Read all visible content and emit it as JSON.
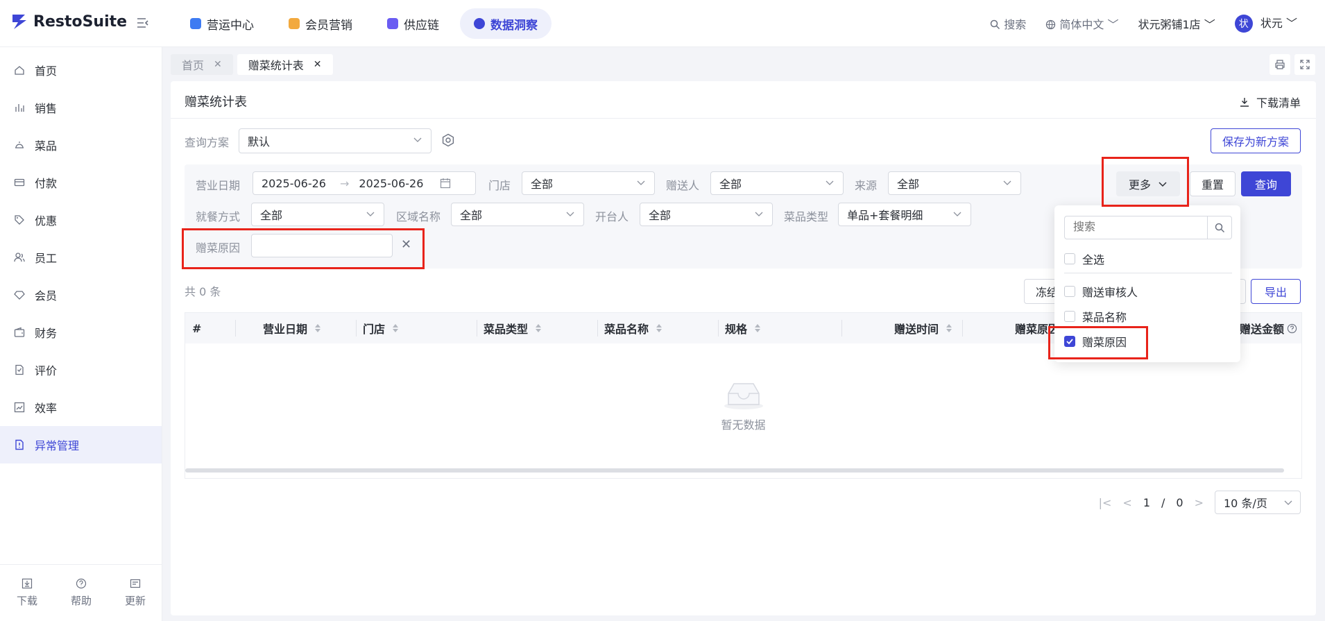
{
  "app": {
    "logo": "RestoSuite"
  },
  "nav": {
    "tabs": [
      {
        "label": "营运中心",
        "color": "#3e7bf2"
      },
      {
        "label": "会员营销",
        "color": "#f2a93e"
      },
      {
        "label": "供应链",
        "color": "#6a5cf2"
      },
      {
        "label": "数据洞察",
        "color": "#3e46d6"
      }
    ],
    "active": "数据洞察"
  },
  "topright": {
    "search": "搜索",
    "language": "简体中文",
    "store": "状元粥铺1店",
    "avatar_char": "状",
    "user": "状元"
  },
  "sidebar": {
    "items": [
      {
        "label": "首页",
        "icon": "home-icon"
      },
      {
        "label": "销售",
        "icon": "bar-chart-icon"
      },
      {
        "label": "菜品",
        "icon": "dish-icon"
      },
      {
        "label": "付款",
        "icon": "card-icon"
      },
      {
        "label": "优惠",
        "icon": "tag-icon"
      },
      {
        "label": "员工",
        "icon": "staff-icon"
      },
      {
        "label": "会员",
        "icon": "diamond-icon"
      },
      {
        "label": "财务",
        "icon": "wallet-icon"
      },
      {
        "label": "评价",
        "icon": "review-icon"
      },
      {
        "label": "效率",
        "icon": "trend-icon"
      },
      {
        "label": "异常管理",
        "icon": "alert-doc-icon"
      }
    ],
    "active": "异常管理",
    "bottom": [
      {
        "label": "下载",
        "icon": "download-icon"
      },
      {
        "label": "帮助",
        "icon": "help-icon"
      },
      {
        "label": "更新",
        "icon": "update-icon"
      }
    ]
  },
  "pagetabs": [
    {
      "label": "首页"
    },
    {
      "label": "赠菜统计表"
    }
  ],
  "page": {
    "title": "赠菜统计表",
    "download_list": "下载清单",
    "plan_label": "查询方案",
    "plan_value": "默认",
    "save_plan": "保存为新方案"
  },
  "filters": {
    "biz_date_label": "营业日期",
    "date_start": "2025-06-26",
    "date_end": "2025-06-26",
    "store_label": "门店",
    "store_value": "全部",
    "giver_label": "赠送人",
    "giver_value": "全部",
    "source_label": "来源",
    "source_value": "全部",
    "dining_label": "就餐方式",
    "dining_value": "全部",
    "area_label": "区域名称",
    "area_value": "全部",
    "opener_label": "开台人",
    "opener_value": "全部",
    "dishtype_label": "菜品类型",
    "dishtype_value": "单品+套餐明细",
    "reason_label": "赠菜原因",
    "reason_value": "",
    "more": "更多",
    "reset": "重置",
    "query": "查询"
  },
  "results": {
    "count": "共 0 条",
    "freeze": "冻结",
    "export": "导出",
    "empty": "暂无数据"
  },
  "table": {
    "columns": [
      "#",
      "营业日期",
      "门店",
      "菜品类型",
      "菜品名称",
      "规格",
      "赠送时间",
      "赠菜原因",
      "赠送金额"
    ]
  },
  "pager": {
    "current": "1",
    "sep": "/",
    "total": "0",
    "page_size": "10 条/页"
  },
  "dropdown": {
    "search_placeholder": "搜索",
    "select_all": "全选",
    "items": [
      {
        "label": "赠送审核人",
        "checked": false
      },
      {
        "label": "菜品名称",
        "checked": false
      },
      {
        "label": "赠菜原因",
        "checked": true
      }
    ]
  },
  "colors": {
    "accent": "#3e46d6",
    "highlight": "#e8231a"
  }
}
